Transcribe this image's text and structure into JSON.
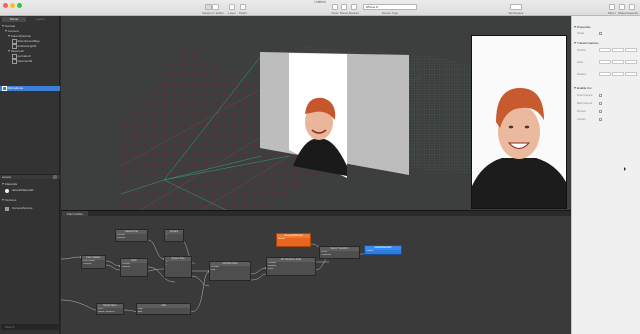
{
  "window": {
    "title": "Untitled"
  },
  "toolbar": {
    "left_buttons": [
      {
        "label": "Viewport / Editor"
      },
      {
        "label": "Layer"
      },
      {
        "label": "Patch"
      }
    ],
    "mid_buttons": [
      {
        "label": "Clear"
      },
      {
        "label": "Pause"
      },
      {
        "label": "Restart"
      }
    ],
    "device_select": "iPhone 8",
    "device_label": "Device Type",
    "workspace_label": "Workspace",
    "right_buttons": [
      {
        "label": "Mirror"
      },
      {
        "label": "Share"
      },
      {
        "label": "Inspector"
      }
    ]
  },
  "left_panel": {
    "tabs": [
      "Scene",
      "Layers"
    ],
    "tree": [
      {
        "label": "Canvas",
        "indent": 0
      },
      {
        "label": "Camera",
        "indent": 1
      },
      {
        "label": "Face Distortion",
        "indent": 1
      },
      {
        "label": "distortionLeftEye",
        "indent": 2
      },
      {
        "label": "ambientLight0",
        "indent": 2
      },
      {
        "label": "facemesh",
        "indent": 1
      },
      {
        "label": "occluder0",
        "indent": 2
      },
      {
        "label": "facemesh0",
        "indent": 2
      },
      {
        "label": "Microphone",
        "indent": 0
      }
    ],
    "assets_header": "Assets",
    "materials_header": "Materials",
    "materials": [
      {
        "label": "defaultMaterial0"
      }
    ],
    "textures_header": "Textures",
    "textures": [
      {
        "label": "CameraTexture"
      }
    ],
    "search_placeholder": "Search"
  },
  "patch_editor": {
    "tab": "Patch Editor",
    "nodes": [
      {
        "title": "Face Tracker",
        "rows": [
          "Face Finder",
          "Tracking"
        ]
      },
      {
        "title": "Camera Tap",
        "rows": [
          "Position",
          "Rotation"
        ]
      },
      {
        "title": "Unpack",
        "rows": [
          "X",
          "Y",
          "Z"
        ]
      },
      {
        "title": "Pack",
        "rows": [
          "Position",
          "Rotation"
        ]
      },
      {
        "title": "Screen Size",
        "rows": [
          "X",
          "Y"
        ]
      },
      {
        "title": "Mouth Open",
        "rows": [
          "Face",
          "Mouth Openness"
        ]
      },
      {
        "title": "Add",
        "rows": [
          "Input",
          "Add"
        ]
      },
      {
        "title": "2D Point Pack",
        "rows": [
          "Position",
          "Size"
        ]
      },
      {
        "title": "3D Transform Pack",
        "rows": [
          "Position",
          "Rotation",
          "Scale"
        ]
      },
      {
        "title": "facemeshNormal",
        "rows": [
          "Normal"
        ],
        "accent": "#e8651d"
      },
      {
        "title": "Vector Transform",
        "rows": [
          "Vector",
          "Transform"
        ]
      },
      {
        "title": "defaultMaterial0",
        "rows": [
          "Texture"
        ],
        "accent": "#2d7de0"
      }
    ]
  },
  "inspector": {
    "sections": [
      {
        "header": "Properties",
        "fields": [
          "Visible"
        ]
      },
      {
        "header": "Transformations",
        "fields": [
          "Position",
          "Scale",
          "Rotation"
        ]
      },
      {
        "header": "Enable For",
        "fields": [
          "Front Camera",
          "Back Camera",
          "Preview",
          "Capture"
        ]
      }
    ]
  },
  "colors": {
    "accent_orange": "#e8651d",
    "accent_blue": "#2d7de0",
    "selection": "#3d7fd6"
  }
}
